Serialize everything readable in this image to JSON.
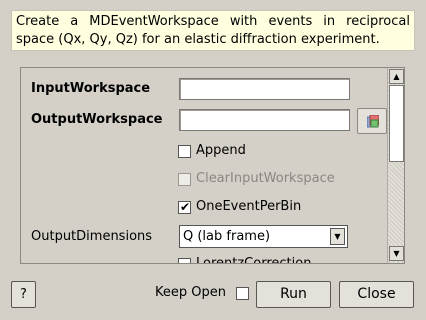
{
  "description": "Create a MDEventWorkspace with events in reciprocal space (Qx, Qy, Qz) for an elastic diffraction experiment.",
  "fields": {
    "input_workspace_label": "InputWorkspace",
    "input_workspace_value": "",
    "output_workspace_label": "OutputWorkspace",
    "output_workspace_value": ""
  },
  "options": {
    "append_label": "Append",
    "append_checked": false,
    "clear_input_label": "ClearInputWorkspace",
    "clear_input_checked": false,
    "one_event_label": "OneEventPerBin",
    "one_event_checked": true,
    "check_mark": "✔",
    "output_dims_label": "OutputDimensions",
    "output_dims_value": "Q (lab frame)",
    "lorentz_label": "LorentzCorrection"
  },
  "buttons": {
    "help": "?",
    "keep_open": "Keep Open",
    "run": "Run",
    "close": "Close"
  },
  "icons": {
    "scroll_up": "▲",
    "scroll_down": "▼",
    "combo_arrow": "▼",
    "browse": "workspace-browse-icon"
  }
}
